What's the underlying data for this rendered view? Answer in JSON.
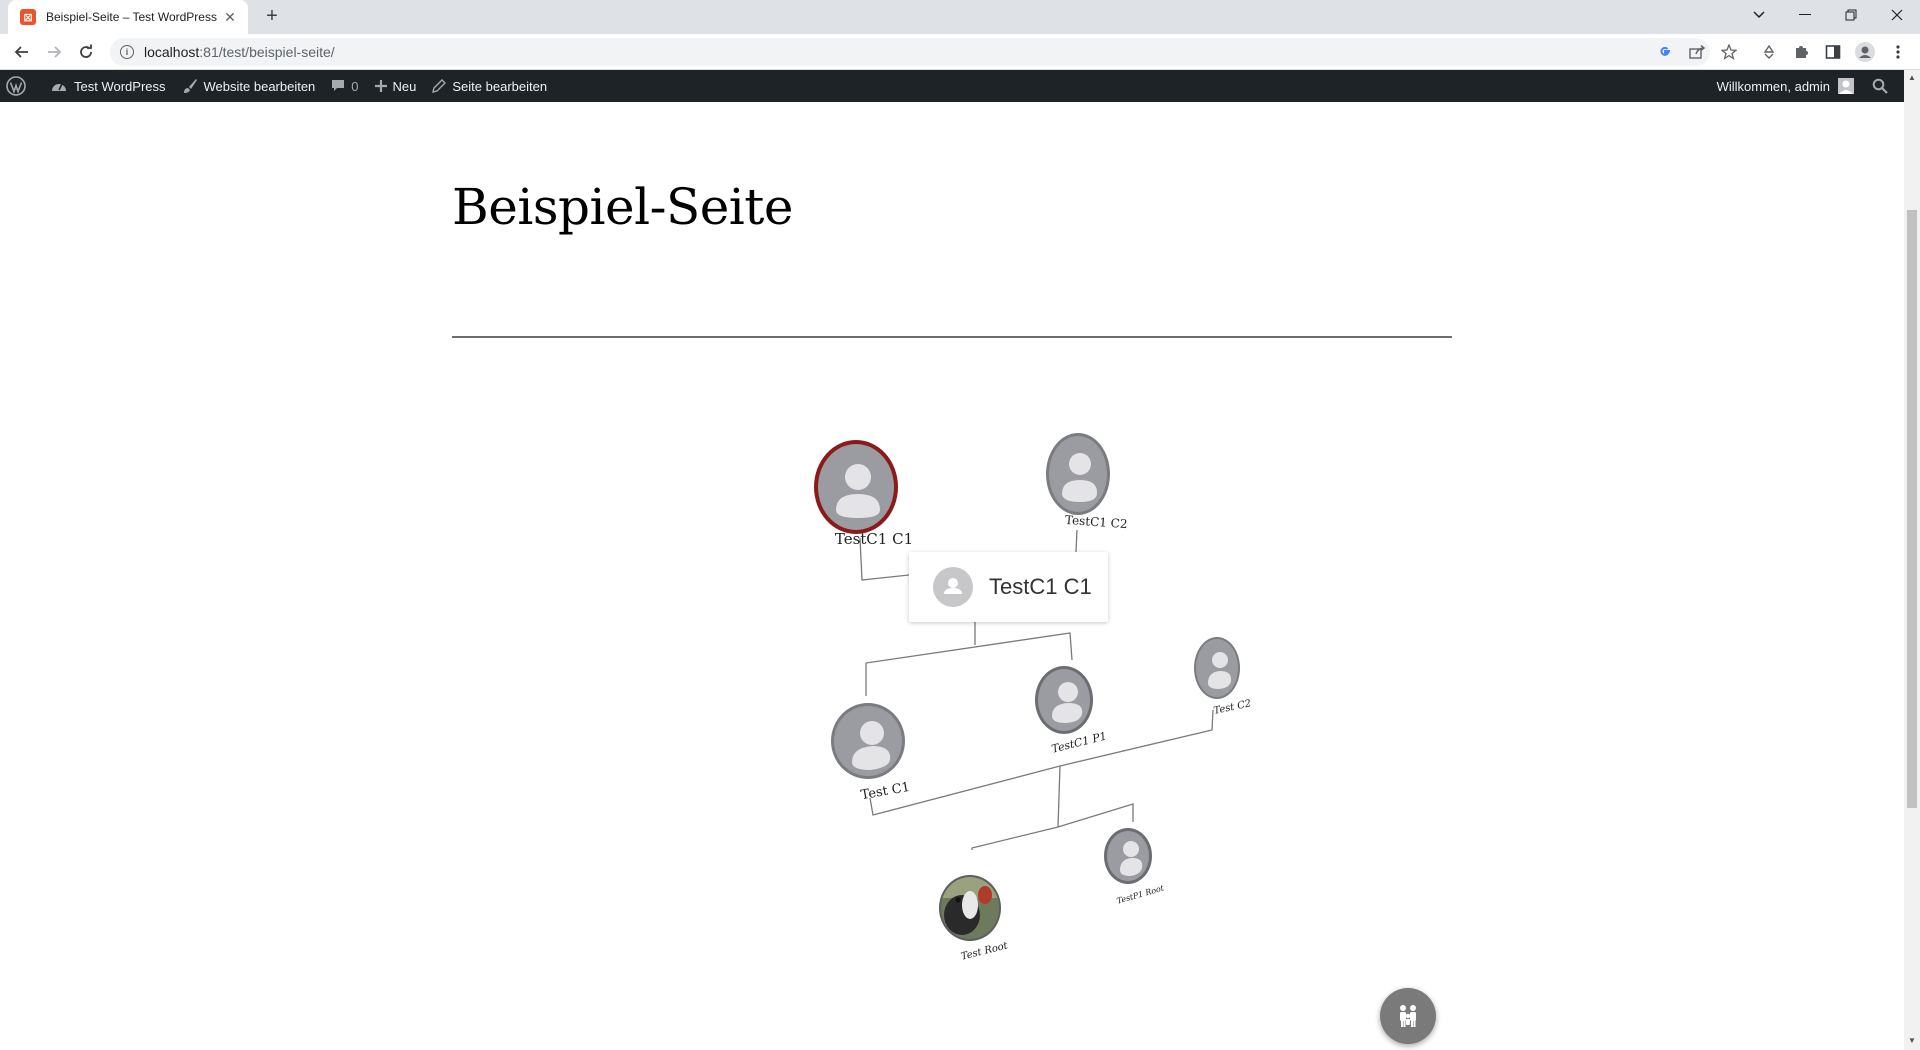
{
  "browser": {
    "tab_title": "Beispiel-Seite – Test WordPress",
    "tab_favicon": "wp-plugin-favicon",
    "url_host": "localhost",
    "url_path": ":81/test/beispiel-seite/"
  },
  "adminbar": {
    "site_name": "Test WordPress",
    "customize": "Website bearbeiten",
    "comments_count": "0",
    "new": "Neu",
    "edit_page": "Seite bearbeiten",
    "greeting": "Willkommen, admin"
  },
  "page": {
    "title": "Beispiel-Seite"
  },
  "family_tree": {
    "selected_card": {
      "name": "TestC1 C1",
      "icon": "person-icon"
    },
    "nodes": [
      {
        "id": "testc1-c1",
        "label": "TestC1 C1",
        "selected": true,
        "accent": "#8b1a1a"
      },
      {
        "id": "testc1-c2",
        "label": "TestC1 C2"
      },
      {
        "id": "test-c1",
        "label": "Test C1"
      },
      {
        "id": "testc1-p1",
        "label": "TestC1 P1"
      },
      {
        "id": "test-c2",
        "label": "Test C2"
      },
      {
        "id": "test-root",
        "label": "Test Root",
        "photo": true
      },
      {
        "id": "testp1-root",
        "label": "TestP1 Root"
      }
    ]
  },
  "fab": {
    "icon": "family-icon"
  },
  "colors": {
    "adminbar_bg": "#1d2327",
    "selected_ring": "#8b1a1a",
    "avatar_grey": "#9a9ca1"
  }
}
